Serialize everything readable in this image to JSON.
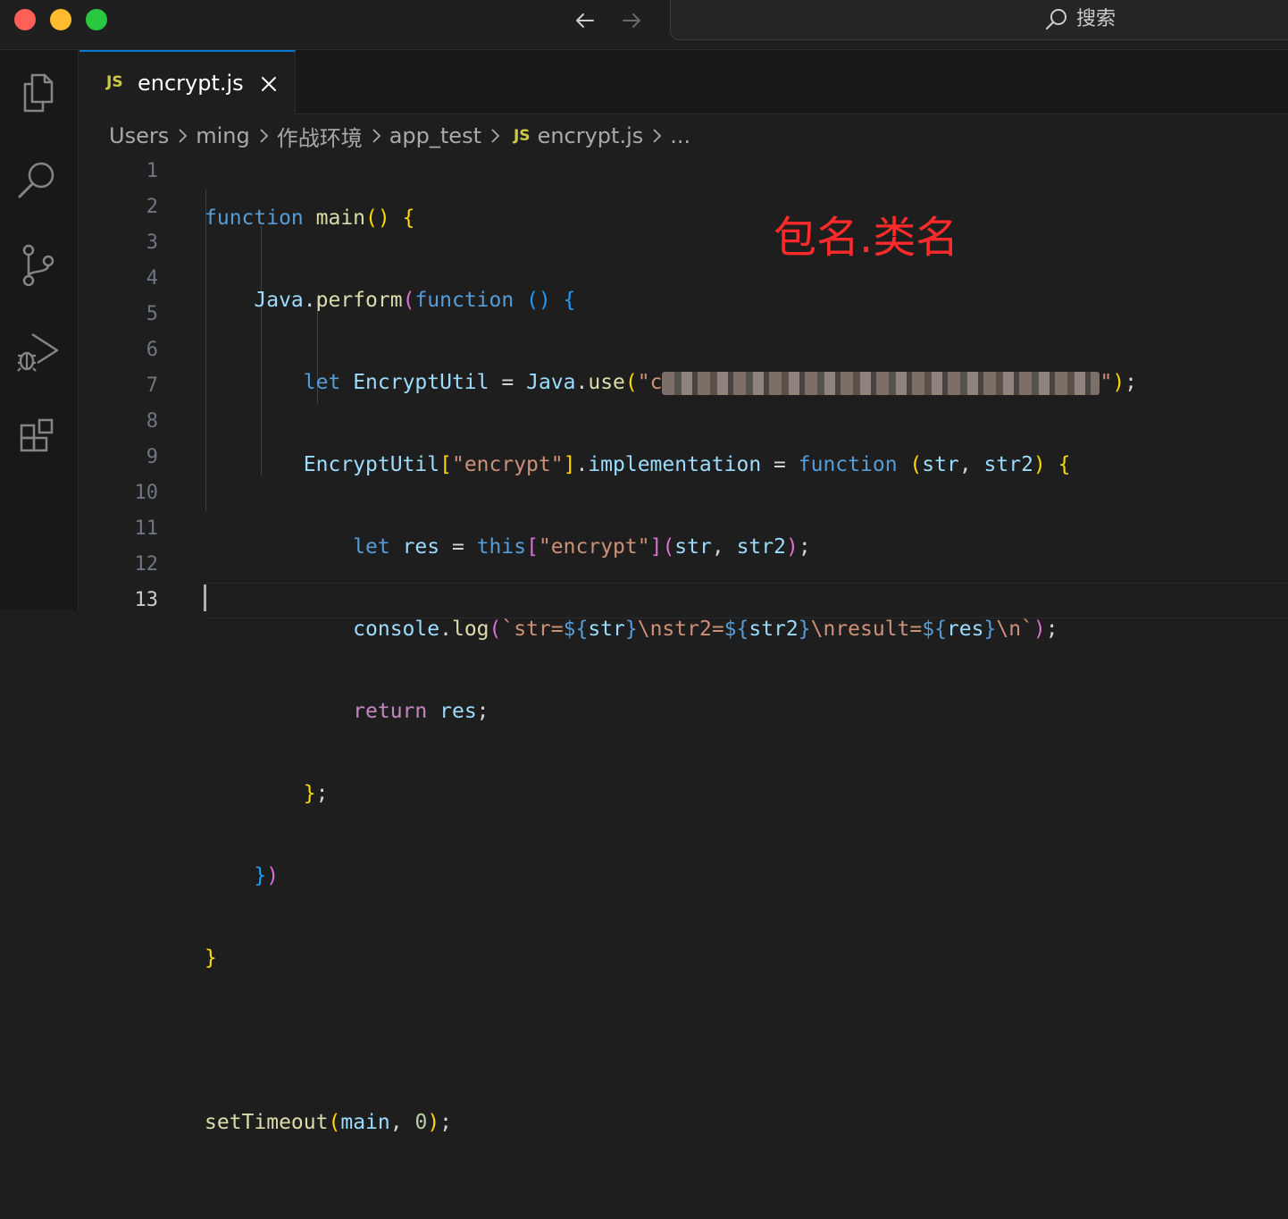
{
  "window": {
    "traffic_lights": {
      "close": "#ff5f57",
      "minimize": "#febc2e",
      "maximize": "#28c840"
    },
    "search_placeholder": "搜索"
  },
  "tab": {
    "badge": "JS",
    "title": "encrypt.js"
  },
  "breadcrumb": {
    "segments": [
      "Users",
      "ming",
      "作战环境",
      "app_test"
    ],
    "file_badge": "JS",
    "file": "encrypt.js",
    "more": "..."
  },
  "line_numbers": [
    "1",
    "2",
    "3",
    "4",
    "5",
    "6",
    "7",
    "8",
    "9",
    "10",
    "11",
    "12",
    "13"
  ],
  "annotation": "包名.类名",
  "code": {
    "l1": {
      "kw": "function",
      "name": "main",
      "parens": "()",
      "brace": "{"
    },
    "l2": {
      "obj": "Java",
      "dot": ".",
      "method": "perform",
      "open": "(",
      "kw": "function",
      "parens": "()",
      "brace": "{"
    },
    "l3": {
      "kw": "let",
      "var": "EncryptUtil",
      "eq": "=",
      "obj": "Java",
      "dot": ".",
      "method": "use",
      "open": "(",
      "str_open": "\"c",
      "str_close": "\"",
      "close": ")",
      "semi": ";"
    },
    "l4": {
      "var": "EncryptUtil",
      "open": "[",
      "str": "\"encrypt\"",
      "close": "]",
      "dot": ".",
      "prop": "implementation",
      "eq": "=",
      "kw": "function",
      "popen": "(",
      "a1": "str",
      "comma": ",",
      "a2": "str2",
      "pclose": ")",
      "brace": "{"
    },
    "l5": {
      "kw": "let",
      "var": "res",
      "eq": "=",
      "self": "this",
      "open": "[",
      "str": "\"encrypt\"",
      "close": "]",
      "popen": "(",
      "a1": "str",
      "comma": ",",
      "a2": "str2",
      "pclose": ")",
      "semi": ";"
    },
    "l6": {
      "obj": "console",
      "dot": ".",
      "method": "log",
      "open": "(",
      "t1": "`str=",
      "e1o": "${",
      "e1": "str",
      "e1c": "}",
      "t2": "\\nstr2=",
      "e2o": "${",
      "e2": "str2",
      "e2c": "}",
      "t3": "\\nresult=",
      "e3o": "${",
      "e3": "res",
      "e3c": "}",
      "t4": "\\n`",
      "close": ")",
      "semi": ";"
    },
    "l7": {
      "kw": "return",
      "var": "res",
      "semi": ";"
    },
    "l8": {
      "brace": "}",
      "semi": ";"
    },
    "l9": {
      "brace": "}",
      "paren": ")"
    },
    "l10": {
      "brace": "}"
    },
    "l12": {
      "fn": "setTimeout",
      "open": "(",
      "arg": "main",
      "comma": ",",
      "num": "0",
      "close": ")",
      "semi": ";"
    }
  }
}
